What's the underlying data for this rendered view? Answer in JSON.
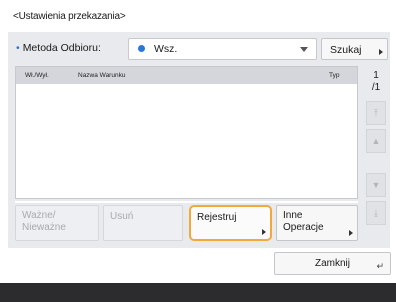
{
  "title": "<Ustawienia przekazania>",
  "method": {
    "label": "Metoda Odbioru:",
    "value": "Wsz.",
    "search_label": "Szukaj"
  },
  "table": {
    "columns": [
      "Wł./Wył.",
      "Nazwa Warunku",
      "Typ"
    ],
    "rows": []
  },
  "pagination": {
    "current": "1",
    "total": "/1"
  },
  "buttons": {
    "valid_invalid": "Ważne/\nNieważne",
    "delete": "Usuń",
    "register": "Rejestruj",
    "other_operations": "Inne\nOperacje",
    "close": "Zamknij"
  },
  "colors": {
    "accent_orange": "#f3a83a",
    "bullet_blue": "#2a78d6",
    "panel_bg": "#e9eaee",
    "bottom_bar": "#2c2c2e"
  },
  "icons": [
    "first-page-icon",
    "prev-page-icon",
    "next-page-icon",
    "last-page-icon",
    "dropdown-caret-icon",
    "return-key-icon"
  ]
}
